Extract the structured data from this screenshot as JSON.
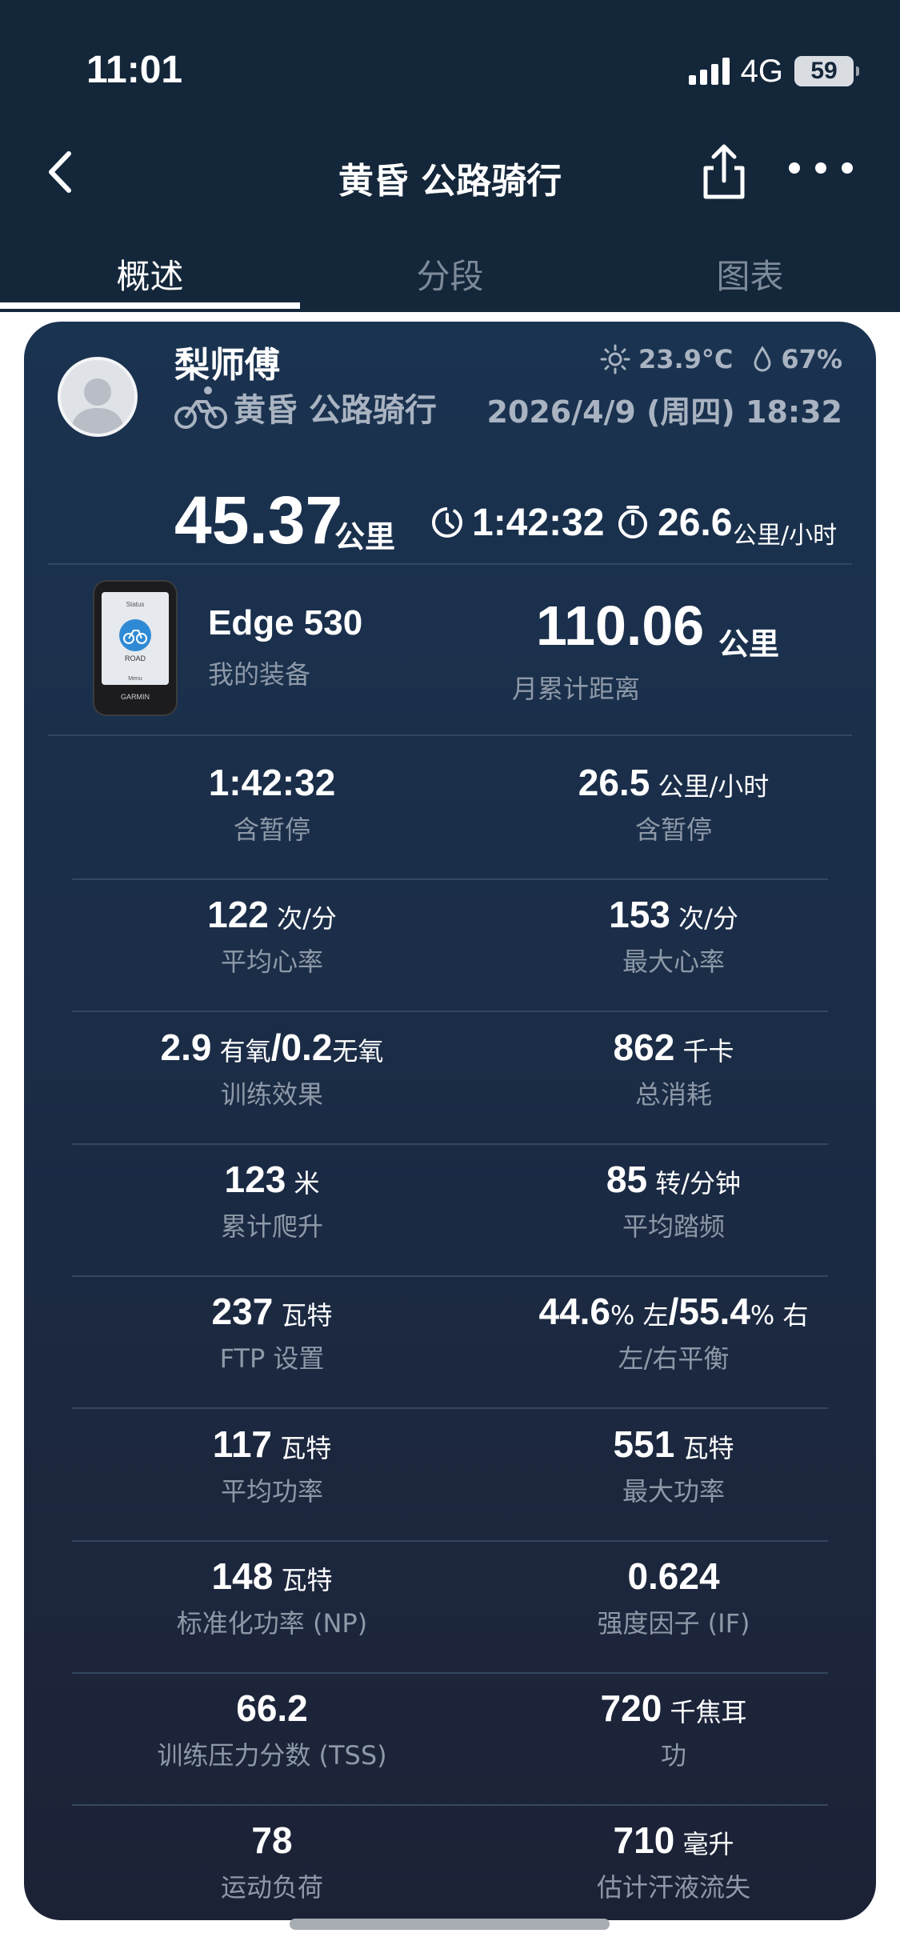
{
  "status_bar": {
    "time": "11:01",
    "network": "4G",
    "battery": "59"
  },
  "nav": {
    "title": "黄昏 公路骑行"
  },
  "tabs": [
    {
      "label": "概述",
      "active": true
    },
    {
      "label": "分段",
      "active": false
    },
    {
      "label": "图表",
      "active": false
    }
  ],
  "activity": {
    "user_name": "梨师傅",
    "type_label": "黄昏 公路骑行",
    "temperature": "23.9°C",
    "humidity": "67%",
    "datetime": "2026/4/9 (周四) 18:32"
  },
  "summary": {
    "distance": "45.37",
    "distance_unit": "公里",
    "time": "1:42:32",
    "speed": "26.6",
    "speed_unit": "公里/小时"
  },
  "device": {
    "name": "Edge 530",
    "label": "我的装备",
    "monthly_distance": "110.06",
    "monthly_unit": "公里",
    "monthly_label": "月累计距离",
    "screen_top": "Status",
    "screen_mid": "ROAD",
    "screen_bottom": "Menu",
    "brand": "GARMIN"
  },
  "stats": [
    {
      "left": {
        "parts": [
          {
            "t": "1:42:32",
            "k": "num"
          }
        ],
        "label": "含暂停"
      },
      "right": {
        "parts": [
          {
            "t": "26.5",
            "k": "num"
          },
          {
            "t": " 公里/小时",
            "k": "unit"
          }
        ],
        "label": "含暂停"
      }
    },
    {
      "left": {
        "parts": [
          {
            "t": "122",
            "k": "num"
          },
          {
            "t": " 次/分",
            "k": "unit"
          }
        ],
        "label": "平均心率"
      },
      "right": {
        "parts": [
          {
            "t": "153",
            "k": "num"
          },
          {
            "t": " 次/分",
            "k": "unit"
          }
        ],
        "label": "最大心率"
      }
    },
    {
      "left": {
        "parts": [
          {
            "t": "2.9",
            "k": "num"
          },
          {
            "t": " 有氧",
            "k": "unit"
          },
          {
            "t": "/0.2",
            "k": "num"
          },
          {
            "t": "无氧",
            "k": "unit"
          }
        ],
        "label": "训练效果"
      },
      "right": {
        "parts": [
          {
            "t": "862",
            "k": "num"
          },
          {
            "t": " 千卡",
            "k": "unit"
          }
        ],
        "label": "总消耗"
      }
    },
    {
      "left": {
        "parts": [
          {
            "t": "123",
            "k": "num"
          },
          {
            "t": " 米",
            "k": "unit"
          }
        ],
        "label": "累计爬升"
      },
      "right": {
        "parts": [
          {
            "t": "85",
            "k": "num"
          },
          {
            "t": " 转/分钟",
            "k": "unit"
          }
        ],
        "label": "平均踏频"
      }
    },
    {
      "left": {
        "parts": [
          {
            "t": "237",
            "k": "num"
          },
          {
            "t": " 瓦特",
            "k": "unit"
          }
        ],
        "label": "FTP 设置"
      },
      "right": {
        "parts": [
          {
            "t": "44.6",
            "k": "num"
          },
          {
            "t": "% 左",
            "k": "unit"
          },
          {
            "t": "/55.4",
            "k": "num"
          },
          {
            "t": "% 右",
            "k": "unit"
          }
        ],
        "label": "左/右平衡"
      }
    },
    {
      "left": {
        "parts": [
          {
            "t": "117",
            "k": "num"
          },
          {
            "t": " 瓦特",
            "k": "unit"
          }
        ],
        "label": "平均功率"
      },
      "right": {
        "parts": [
          {
            "t": "551",
            "k": "num"
          },
          {
            "t": " 瓦特",
            "k": "unit"
          }
        ],
        "label": "最大功率"
      }
    },
    {
      "left": {
        "parts": [
          {
            "t": "148",
            "k": "num"
          },
          {
            "t": " 瓦特",
            "k": "unit"
          }
        ],
        "label": "标准化功率 (NP)"
      },
      "right": {
        "parts": [
          {
            "t": "0.624",
            "k": "num"
          }
        ],
        "label": "强度因子 (IF)"
      }
    },
    {
      "left": {
        "parts": [
          {
            "t": "66.2",
            "k": "num"
          }
        ],
        "label": "训练压力分数 (TSS)"
      },
      "right": {
        "parts": [
          {
            "t": "720",
            "k": "num"
          },
          {
            "t": " 千焦耳",
            "k": "unit"
          }
        ],
        "label": "功"
      }
    },
    {
      "left": {
        "parts": [
          {
            "t": "78",
            "k": "num"
          }
        ],
        "label": "运动负荷"
      },
      "right": {
        "parts": [
          {
            "t": "710",
            "k": "num"
          },
          {
            "t": " 毫升",
            "k": "unit"
          }
        ],
        "label": "估计汗液流失"
      }
    }
  ]
}
